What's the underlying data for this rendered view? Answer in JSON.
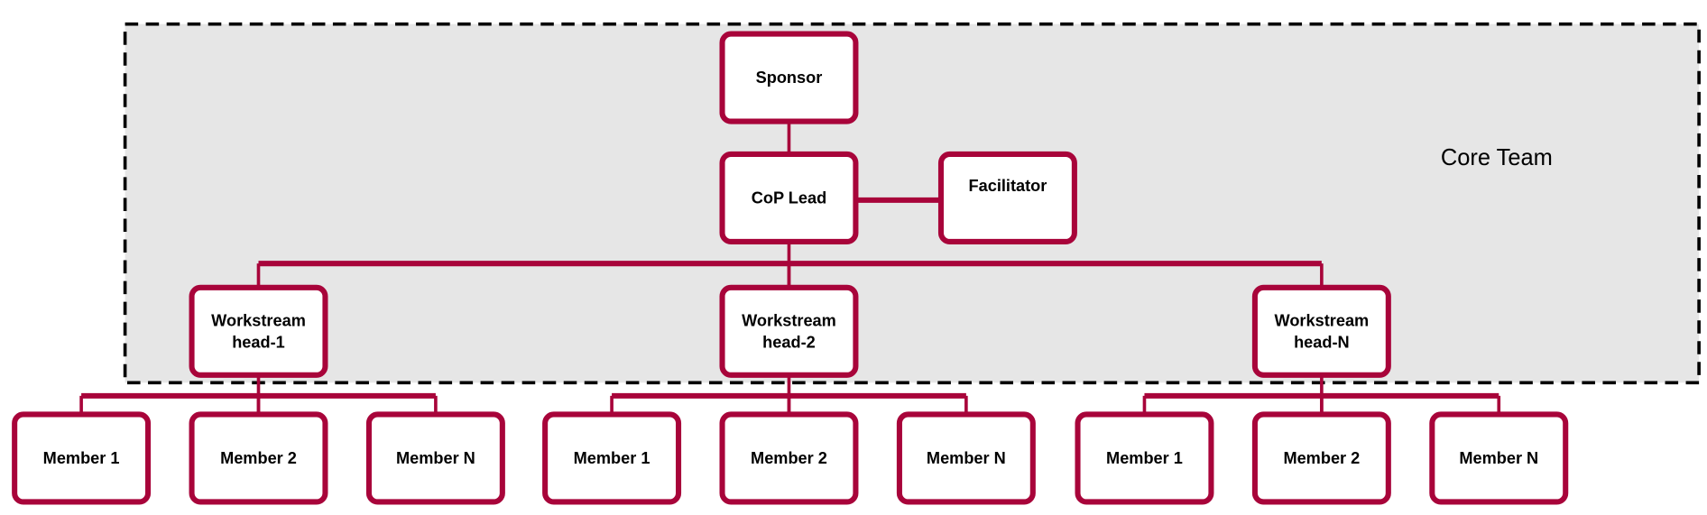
{
  "colors": {
    "accent": "#a8043a",
    "group_fill": "#e6e6e6",
    "box_fill": "#ffffff",
    "dash": "#000000"
  },
  "group": {
    "label": "Core Team"
  },
  "nodes": {
    "sponsor": {
      "lines": [
        "Sponsor"
      ]
    },
    "cop_lead": {
      "lines": [
        "CoP Lead"
      ]
    },
    "facilitator": {
      "lines": [
        "Facilitator"
      ]
    },
    "heads": [
      {
        "lines": [
          "Workstream",
          "head-1"
        ]
      },
      {
        "lines": [
          "Workstream",
          "head-2"
        ]
      },
      {
        "lines": [
          "Workstream",
          "head-N"
        ]
      }
    ],
    "members": [
      [
        "Member 1",
        "Member 2",
        "Member N"
      ],
      [
        "Member 1",
        "Member 2",
        "Member N"
      ],
      [
        "Member 1",
        "Member 2",
        "Member N"
      ]
    ]
  }
}
